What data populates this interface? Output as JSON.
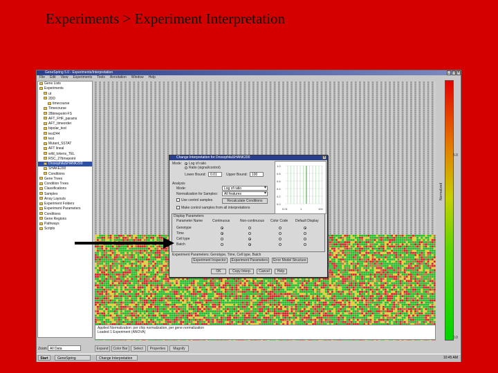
{
  "slide": {
    "title": "Experiments > Experiment Interpretation"
  },
  "window": {
    "title": "GeneSpring 5.0 - Experiments/Interpretation",
    "menu": [
      "File",
      "Edit",
      "View",
      "Experiments",
      "Tools",
      "Annotation",
      "Window",
      "Help"
    ]
  },
  "tree": {
    "items": [
      "Gene Lists",
      "Experiments",
      "ut",
      "2DD",
      "timecourse",
      "Timecourse",
      "28timepoint-FS",
      "AFT_FHF_params",
      "AFT_timeorder",
      "bipolar_test",
      "test244",
      "test",
      "Mutant_SSTAT",
      "AFT lineal",
      "wild_tokens_TEL",
      "RSC_27timepoint",
      "DrosophilaSHANK200",
      "SHAKE200",
      "Conditions",
      "Gene Trees",
      "Condition Trees",
      "Classifications",
      "Samples",
      "Array Layouts",
      "Experiment Folders",
      "Experiment Parameters",
      "Conditions",
      "Gene Regions",
      "Pathways",
      "Scripts"
    ]
  },
  "colorbar": {
    "top_label": "5.0",
    "bottom_label": "0.0",
    "side_label": "Normalized"
  },
  "log": {
    "line1": "Applied Normalization: per chip normalization, per gene normalization",
    "line2": "Loaded 1 Experiment (ANOVA)"
  },
  "bottom": {
    "zoom_label": "Zoom",
    "zoom_value": "All Data",
    "buttons": [
      "Expand",
      "Color Bar",
      "Select",
      "Properties",
      "Magnify"
    ]
  },
  "taskbar": {
    "start": "Start",
    "tasks": [
      "GeneSpring",
      "Change Interpretation"
    ],
    "clock": "10:45 AM"
  },
  "dialog": {
    "title": "Change Interpretation for DrosophilaSHANK200",
    "mode_label": "Mode:",
    "mode_options": [
      "Log of ratio",
      "Ratio (signal/control)"
    ],
    "lower_label": "Lower Bound:",
    "lower_value": "0.01",
    "upper_label": "Upper Bound:",
    "upper_value": "100",
    "analysis_header": "Analysis",
    "mode2_label": "Mode:",
    "mode2_value": "Log of ratio",
    "sample_label": "Normalization for Samples:",
    "sample_value": "All features",
    "control_label": "Use control samples",
    "make_ctrl_button": "Recalculate Conditions",
    "exclude_label": "Make control samples from all interpretations",
    "params_header": "Display Parameters",
    "table_headers": [
      "Parameter Name",
      "Continuous",
      "Non-continuous",
      "Color Code",
      "Default Display"
    ],
    "table_rows": [
      "Genotype",
      "Time",
      "Cell type",
      "Batch"
    ],
    "exp_params_label": "Experiment Parameters: Genotype, Time, Cell type, Batch",
    "buttons_top": [
      "Experiment Inspector",
      "Experiment Parameters",
      "Error Model Structure"
    ],
    "buttons_bottom": [
      "OK",
      "Copy Interp",
      "Cancel",
      "Help"
    ],
    "graph_y_ticks": [
      "1.0",
      "0.8",
      "0.6",
      "0.4",
      "0.2",
      "0.0"
    ],
    "graph_x_ticks": [
      "0.01",
      "1",
      "100"
    ]
  },
  "colors": {
    "slide_bg": "#d40000",
    "heat_red": "#e02020",
    "heat_green": "#20c020",
    "heat_yellow": "#e8d020",
    "heat_gray": "#9a9a9a"
  }
}
